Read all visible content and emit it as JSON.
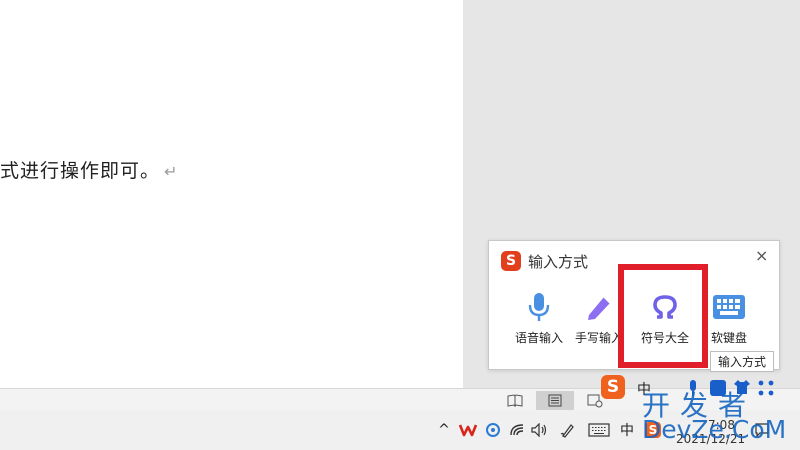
{
  "document": {
    "text": "式进行操作即可。",
    "paragraph_mark": "↵"
  },
  "status_bar": {
    "views": [
      {
        "name": "reading-view",
        "icon": "book-icon"
      },
      {
        "name": "page-view",
        "icon": "page-icon",
        "active": true
      },
      {
        "name": "web-view",
        "icon": "web-icon"
      }
    ]
  },
  "taskbar": {
    "show_hidden": "^",
    "ime_lang": "中",
    "date": "2021/12/21",
    "time": "7:08"
  },
  "ime_panel": {
    "logo": "S",
    "title": "输入方式",
    "close": "×",
    "items": [
      {
        "label": "语音输入",
        "icon": "microphone-icon"
      },
      {
        "label": "手写输入",
        "icon": "pen-icon"
      },
      {
        "label": "符号大全",
        "icon": "omega-icon",
        "highlighted": true
      },
      {
        "label": "软键盘",
        "icon": "keyboard-icon"
      }
    ],
    "tooltip": "输入方式"
  },
  "ime_toolbar": {
    "logo": "S",
    "lang": "中"
  },
  "watermark": {
    "line1": "开发者",
    "line2": "DevZe.CoM"
  },
  "colors": {
    "highlight": "#e01f2a",
    "sogou_red": "#e2401c",
    "icon_blue": "#4a90e2",
    "icon_purple": "#7b68ee",
    "watermark": "#1565c0"
  }
}
